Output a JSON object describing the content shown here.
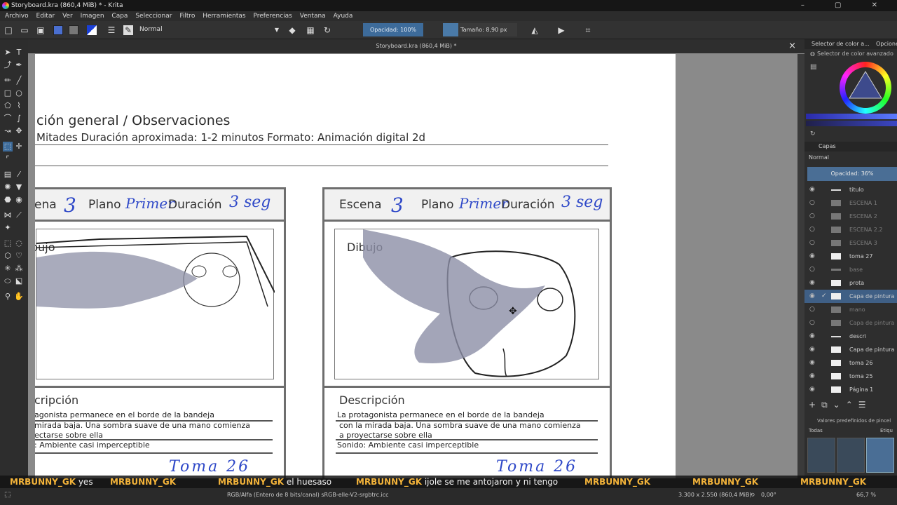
{
  "window": {
    "title": "Storyboard.kra (860,4 MiB) * - Krita",
    "controls": "– ▢ ✕"
  },
  "menu": [
    "Archivo",
    "Editar",
    "Ver",
    "Imagen",
    "Capa",
    "Seleccionar",
    "Filtro",
    "Herramientas",
    "Preferencias",
    "Ventana",
    "Ayuda"
  ],
  "toolbar": {
    "blend_mode": "Normal",
    "opacity": "Opacidad: 100%",
    "size": "Tamaño: 8,90 px"
  },
  "doc_tab": {
    "title": "Storyboard.kra (860,4 MiB) *"
  },
  "canvas": {
    "heading": "ción general / Observaciones",
    "subline": "Mitades Duración aproximada: 1-2 minutos Formato: Animación digital 2d",
    "panels": [
      {
        "escena_label": "ena",
        "escena_val": "3",
        "plano_label": "Plano",
        "plano_val": "Primer",
        "duracion_label": "Duración",
        "duracion_val": "3 seg",
        "dibujo": "bujo",
        "desc_title": "cripción",
        "desc_lines": [
          "agonista permanece en el borde de la bandeja",
          "mirada baja. Una sombra suave de una mano comienza",
          "ectarse sobre ella",
          ": Ambiente casi imperceptible"
        ],
        "toma": "Toma 26"
      },
      {
        "escena_label": "Escena",
        "escena_val": "3",
        "plano_label": "Plano",
        "plano_val": "Primer",
        "duracion_label": "Duración",
        "duracion_val": "3 seg",
        "dibujo": "Dibujo",
        "desc_title": "Descripción",
        "desc_lines": [
          "La protagonista permanece en el borde de la bandeja",
          "con la mirada baja. Una sombra suave de una mano comienza",
          "a proyectarse sobre ella",
          "Sonido: Ambiente casi imperceptible"
        ],
        "toma": "Toma 26"
      }
    ]
  },
  "right_dock": {
    "tabs": [
      "Selector de color a...",
      "Opcione"
    ],
    "color_selector_title": "Selector de color avanzado",
    "layers_title": "Capas",
    "layers_blend": "Normal",
    "layers_opacity": "Opacidad: 36%",
    "layers": [
      {
        "name": "titulo",
        "visible": true
      },
      {
        "name": "ESCENA 1",
        "visible": false
      },
      {
        "name": "ESCENA 2",
        "visible": false
      },
      {
        "name": "ESCENA 2.2",
        "visible": false
      },
      {
        "name": "ESCENA 3",
        "visible": false
      },
      {
        "name": "toma 27",
        "visible": true
      },
      {
        "name": "base",
        "visible": false
      },
      {
        "name": "prota",
        "visible": true
      },
      {
        "name": "Capa de pintura",
        "visible": true,
        "selected": true
      },
      {
        "name": "mano",
        "visible": false
      },
      {
        "name": "Capa de pintura",
        "visible": false
      },
      {
        "name": "descri",
        "visible": true
      },
      {
        "name": "Capa de pintura",
        "visible": true
      },
      {
        "name": "toma 26",
        "visible": true
      },
      {
        "name": "toma 25",
        "visible": true
      },
      {
        "name": "Página 1",
        "visible": true
      }
    ],
    "brush_presets_title": "Valores predefinidos de pincel",
    "brush_filter": "Todas",
    "brush_tag": "Etiqu"
  },
  "chat": [
    {
      "user": "MRBUNNY_GK",
      "msg": "yes"
    },
    {
      "user": "MRBUNNY_GK",
      "msg": ""
    },
    {
      "user": "MRBUNNY_GK",
      "msg": "el huesaso"
    },
    {
      "user": "MRBUNNY_GK",
      "msg": "ijole se me antojaron y ni tengo"
    },
    {
      "user": "MRBUNNY_GK",
      "msg": ""
    },
    {
      "user": "MRBUNNY_GK",
      "msg": ""
    },
    {
      "user": "MRBUNNY_GK",
      "msg": ""
    }
  ],
  "status": {
    "color_model": "RGB/Alfa (Entero de 8 bits/canal)  sRGB-elle-V2-srgbtrc.icc",
    "dimensions": "3.300 x 2.550 (860,4 MiB)",
    "rotation": "0,00°",
    "zoom": "66,7 %"
  },
  "colors": {
    "accent": "#3d6b9a",
    "handwriting": "#2f49c8",
    "chat_user": "#f4b43a"
  }
}
